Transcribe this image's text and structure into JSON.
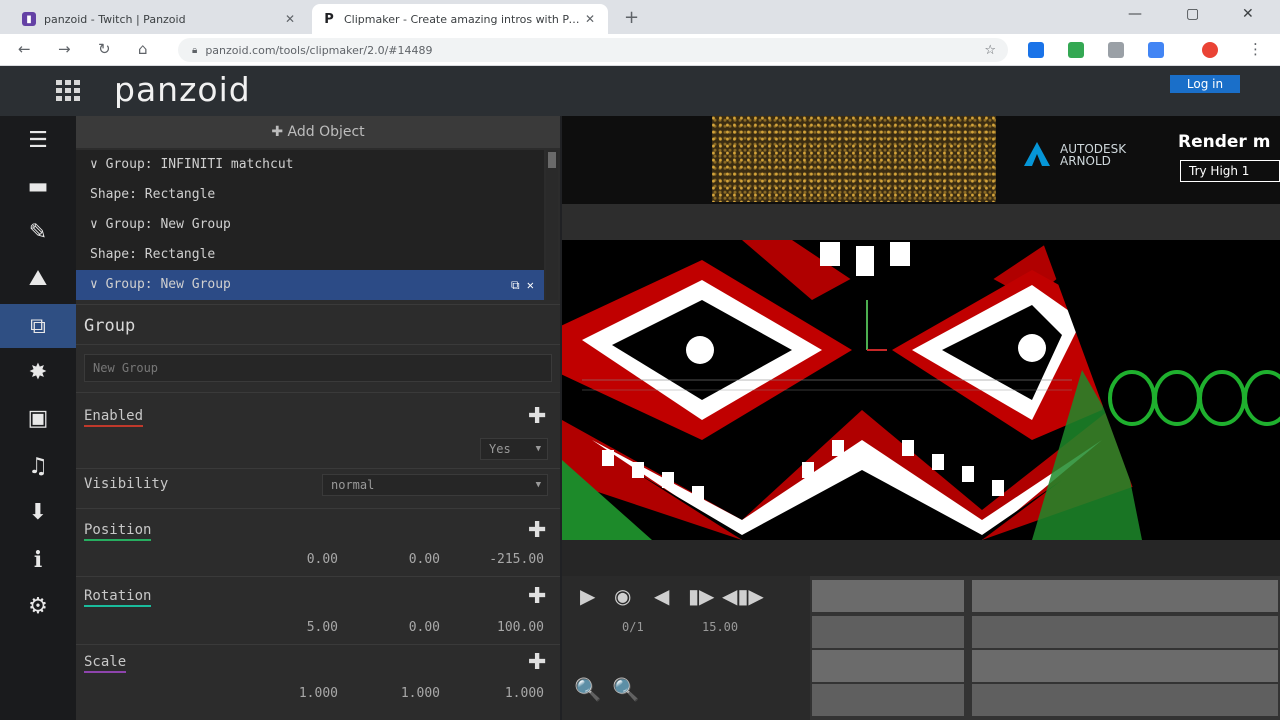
{
  "browser": {
    "tabs": [
      {
        "title": "panzoid - Twitch | Panzoid",
        "icon": "twitch-icon"
      },
      {
        "title": "Clipmaker - Create amazing intros with Panzoid",
        "icon": "panzoid-p-icon"
      }
    ],
    "new_tab": "+",
    "url": "panzoid.com/tools/clipmaker/2.0/#14489",
    "controls": {
      "minimize": "—",
      "maximize": "▢",
      "close": "✕"
    }
  },
  "app": {
    "logo": "panzoid",
    "login": "Log in"
  },
  "sidebar": {
    "items": [
      {
        "icon": "menu-icon",
        "glyph": "☰"
      },
      {
        "icon": "folder-icon",
        "glyph": "▬"
      },
      {
        "icon": "edit-icon",
        "glyph": "✎"
      },
      {
        "icon": "landscape-icon",
        "glyph": "⛰"
      },
      {
        "icon": "objects-icon",
        "glyph": "⧉"
      },
      {
        "icon": "effects-icon",
        "glyph": "✸"
      },
      {
        "icon": "camera-icon",
        "glyph": "▣"
      },
      {
        "icon": "music-icon",
        "glyph": "♫"
      },
      {
        "icon": "download-icon",
        "glyph": "⬇"
      },
      {
        "icon": "info-icon",
        "glyph": "i"
      },
      {
        "icon": "settings-icon",
        "glyph": "⚙"
      }
    ],
    "active_index": 4
  },
  "editor": {
    "add_object": "✚ Add Object",
    "tree": [
      {
        "label": "∨ Group: INFINITI matchcut"
      },
      {
        "label": "Shape: Rectangle"
      },
      {
        "label": "∨ Group: New Group"
      },
      {
        "label": "Shape: Rectangle"
      },
      {
        "label": "∨ Group: New Group",
        "actions": "⧉ ✕"
      }
    ],
    "section_title": "Group",
    "name_value": "New Group",
    "props": {
      "enabled": {
        "label": "Enabled",
        "value": "Yes"
      },
      "visibility": {
        "label": "Visibility",
        "value": "normal"
      },
      "position": {
        "label": "Position",
        "values": [
          "0.00",
          "0.00",
          "-215.00"
        ]
      },
      "rotation": {
        "label": "Rotation",
        "values": [
          "5.00",
          "0.00",
          "100.00"
        ]
      },
      "scale": {
        "label": "Scale",
        "values": [
          "1.000",
          "1.000",
          "1.000"
        ]
      }
    },
    "plus": "✚"
  },
  "ad": {
    "brand": "AUTODESK ARNOLD",
    "headline": "Render m",
    "cta": "Try High 1"
  },
  "playback": {
    "buttons": [
      "▶",
      "◉",
      "◀",
      "▮▶",
      "◀▮▶"
    ],
    "frame": "0/1",
    "time": "15.00",
    "zoom_out": "🔍",
    "zoom_in": "🔍"
  },
  "colors": {
    "accent": "#2f4f83",
    "login_bg": "#1a6fc9",
    "red": "#c0392b",
    "green": "#27ae60"
  }
}
